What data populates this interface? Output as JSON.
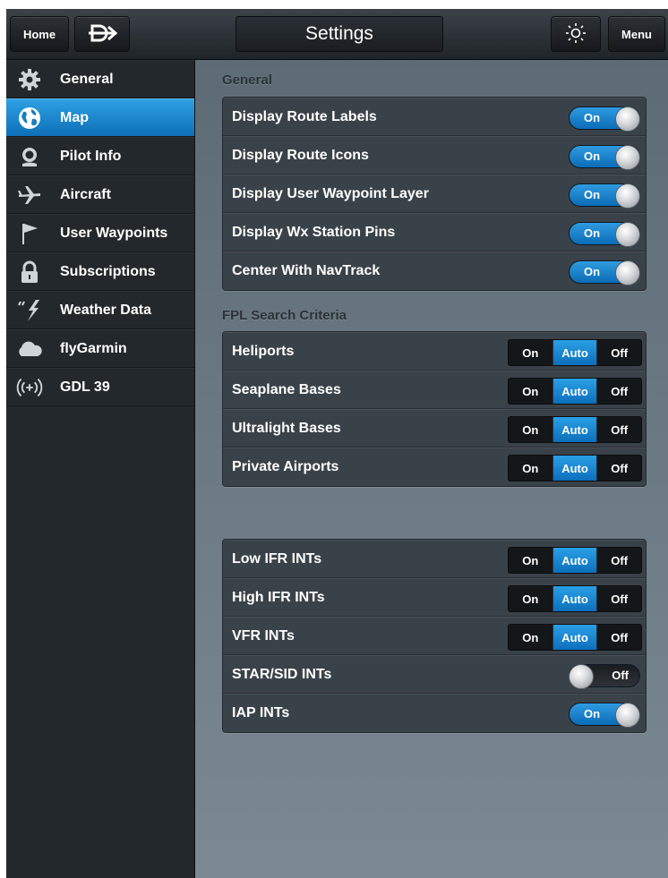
{
  "topbar": {
    "home_label": "Home",
    "title": "Settings",
    "menu_label": "Menu",
    "direct_to_icon": "direct-to-icon",
    "brightness_icon": "brightness-icon"
  },
  "sidebar": {
    "items": [
      {
        "label": "General",
        "icon": "gear-icon",
        "active": false
      },
      {
        "label": "Map",
        "icon": "globe-icon",
        "active": true
      },
      {
        "label": "Pilot Info",
        "icon": "pilot-icon",
        "active": false
      },
      {
        "label": "Aircraft",
        "icon": "airplane-icon",
        "active": false
      },
      {
        "label": "User Waypoints",
        "icon": "flag-icon",
        "active": false
      },
      {
        "label": "Subscriptions",
        "icon": "lock-icon",
        "active": false
      },
      {
        "label": "Weather Data",
        "icon": "lightning-icon",
        "active": false
      },
      {
        "label": "flyGarmin",
        "icon": "cloud-icon",
        "active": false
      },
      {
        "label": "GDL 39",
        "icon": "wireless-icon",
        "active": false
      }
    ]
  },
  "main": {
    "general": {
      "header": "General",
      "rows": [
        {
          "label": "Display Route Labels",
          "value": "On"
        },
        {
          "label": "Display Route Icons",
          "value": "On"
        },
        {
          "label": "Display User Waypoint Layer",
          "value": "On"
        },
        {
          "label": "Display Wx Station Pins",
          "value": "On"
        },
        {
          "label": "Center With NavTrack",
          "value": "On"
        }
      ]
    },
    "fpl": {
      "header": "FPL Search Criteria",
      "options": [
        "On",
        "Auto",
        "Off"
      ],
      "rows": [
        {
          "label": "Heliports",
          "selected": "Auto"
        },
        {
          "label": "Seaplane Bases",
          "selected": "Auto"
        },
        {
          "label": "Ultralight Bases",
          "selected": "Auto"
        },
        {
          "label": "Private Airports",
          "selected": "Auto"
        }
      ]
    },
    "ints": {
      "tri_rows": [
        {
          "label": "Low IFR INTs",
          "selected": "Auto"
        },
        {
          "label": "High IFR INTs",
          "selected": "Auto"
        },
        {
          "label": "VFR INTs",
          "selected": "Auto"
        }
      ],
      "star_sid": {
        "label": "STAR/SID INTs",
        "value": "Off"
      },
      "iap": {
        "label": "IAP INTs",
        "value": "On"
      }
    }
  },
  "colors": {
    "accent_blue": "#1a86d0",
    "background_slate": "#6c7a84",
    "sidebar_dark": "#23282c"
  }
}
